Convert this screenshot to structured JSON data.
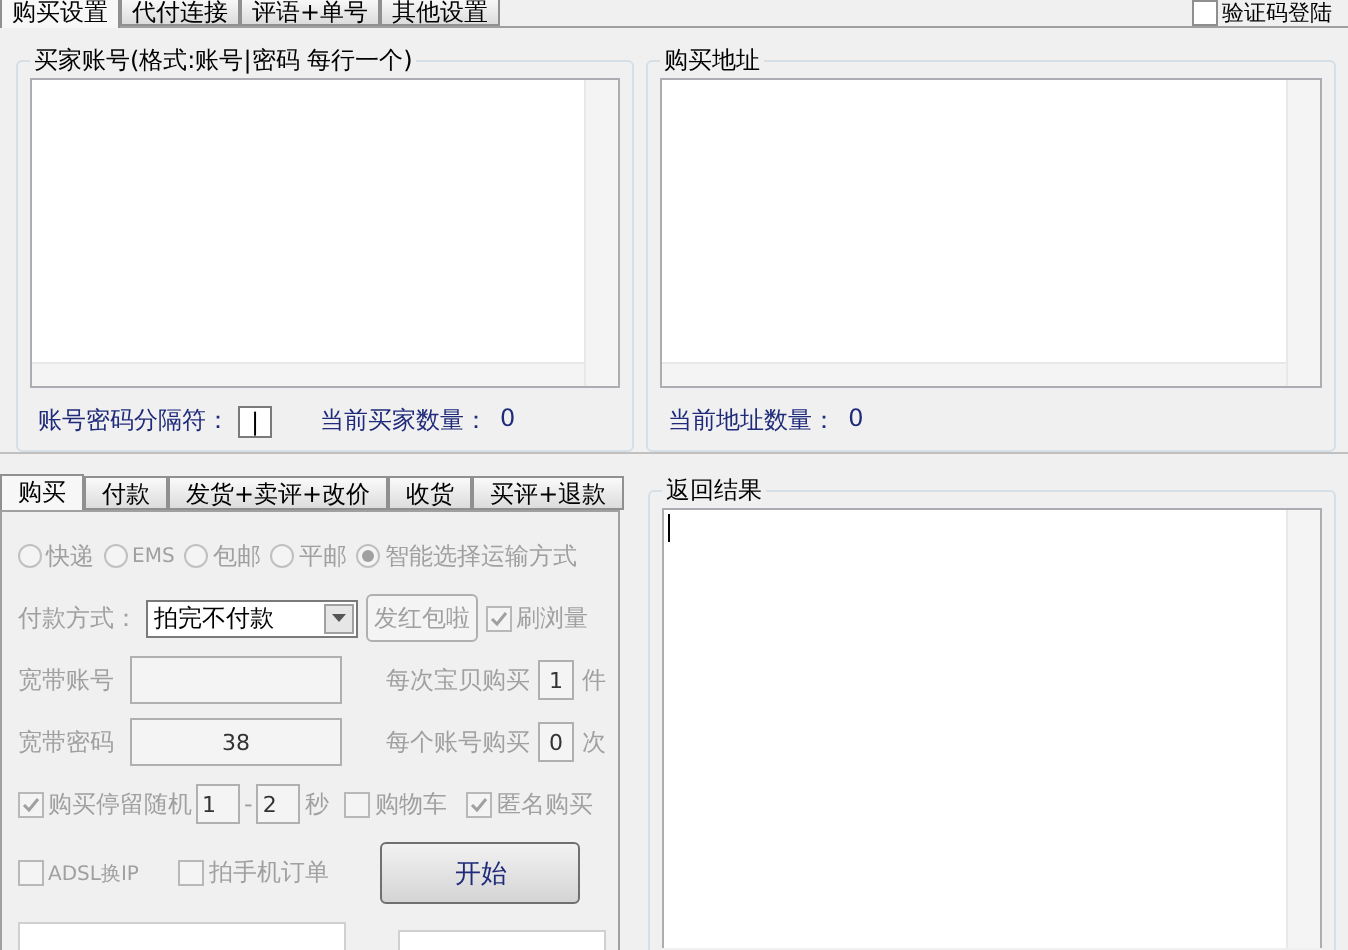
{
  "top_tabs": [
    {
      "label": "购买设置",
      "selected": true
    },
    {
      "label": "代付连接",
      "selected": false
    },
    {
      "label": "评语+单号",
      "selected": false
    },
    {
      "label": "其他设置",
      "selected": false
    }
  ],
  "captcha_login": {
    "label": "验证码登陆",
    "checked": false
  },
  "buyer_accounts": {
    "title": "买家账号(格式:账号|密码 每行一个)",
    "separator_label": "账号密码分隔符：",
    "separator_value": "|",
    "count_label": "当前买家数量：",
    "count": "0"
  },
  "addresses": {
    "title": "购买地址",
    "count_label": "当前地址数量：",
    "count": "0"
  },
  "action_tabs": [
    {
      "label": "购买",
      "selected": true
    },
    {
      "label": "付款",
      "selected": false
    },
    {
      "label": "发货+卖评+改价",
      "selected": false
    },
    {
      "label": "收货",
      "selected": false
    },
    {
      "label": "买评+退款",
      "selected": false
    }
  ],
  "purchase_form": {
    "disabled": true,
    "shipping_options": [
      {
        "label": "快递",
        "selected": false
      },
      {
        "label": "EMS",
        "selected": false
      },
      {
        "label": "包邮",
        "selected": false
      },
      {
        "label": "平邮",
        "selected": false
      },
      {
        "label": "智能选择运输方式",
        "selected": true
      }
    ],
    "payment": {
      "label": "付款方式：",
      "value": "拍完不付款"
    },
    "red_packet_button": "发红包啦",
    "brush_views": {
      "label": "刷浏量",
      "checked": true
    },
    "broadband_account": {
      "label": "宽带账号"
    },
    "broadband_password": {
      "label": "宽带密码",
      "value": "38"
    },
    "per_item": {
      "label": "每次宝贝购买",
      "value": "1",
      "unit": "件"
    },
    "per_account": {
      "label": "每个账号购买",
      "value": "0",
      "unit": "次"
    },
    "stay_random": {
      "label": "购买停留随机",
      "checked": true,
      "from": "1",
      "separator": "-",
      "to": "2",
      "unit": "秒"
    },
    "cart": {
      "label": "购物车",
      "checked": false
    },
    "anonymous": {
      "label": "匿名购买",
      "checked": true
    },
    "adsl": {
      "label": "ADSL换IP",
      "checked": false
    },
    "mobile_order": {
      "label": "拍手机订单",
      "checked": false
    }
  },
  "start_button": "开始",
  "result": {
    "title": "返回结果"
  }
}
